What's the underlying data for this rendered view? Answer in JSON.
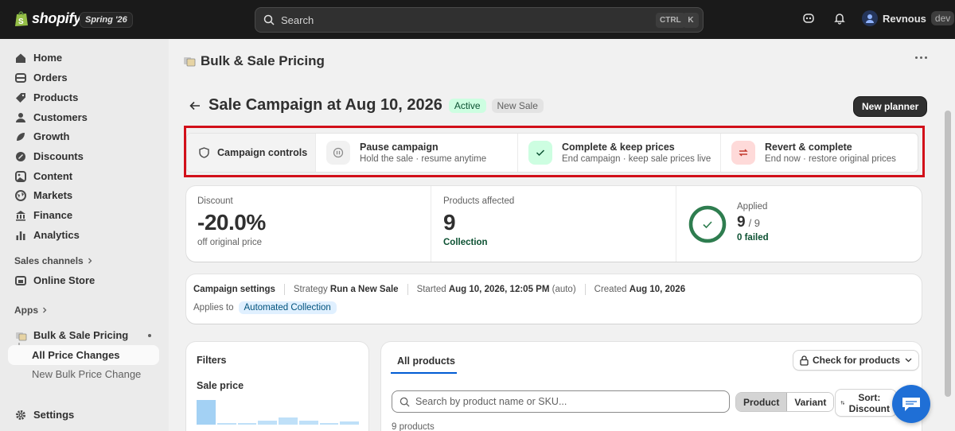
{
  "topbar": {
    "logo_text": "shopify",
    "release_badge": "Spring '26",
    "search_placeholder": "Search",
    "shortcut_ctrl": "CTRL",
    "shortcut_key": "K",
    "user_name": "Revnous",
    "user_badge": "dev"
  },
  "sidebar": {
    "items": [
      {
        "label": "Home",
        "icon": "home-icon"
      },
      {
        "label": "Orders",
        "icon": "orders-icon"
      },
      {
        "label": "Products",
        "icon": "tag-icon"
      },
      {
        "label": "Customers",
        "icon": "person-icon"
      },
      {
        "label": "Growth",
        "icon": "growth-icon"
      },
      {
        "label": "Discounts",
        "icon": "discount-icon"
      },
      {
        "label": "Content",
        "icon": "content-icon"
      },
      {
        "label": "Markets",
        "icon": "globe-icon"
      },
      {
        "label": "Finance",
        "icon": "bank-icon"
      },
      {
        "label": "Analytics",
        "icon": "bar-chart-icon"
      }
    ],
    "sales_channels_label": "Sales channels",
    "online_store_label": "Online Store",
    "apps_label": "Apps",
    "app_label": "Bulk & Sale Pricing",
    "app_sub_items": [
      "All Price Changes",
      "New Bulk Price Change"
    ],
    "settings_label": "Settings"
  },
  "app_header": {
    "title": "Bulk & Sale Pricing"
  },
  "page": {
    "title": "Sale Campaign at Aug 10, 2026",
    "status_badge": "Active",
    "type_badge": "New Sale",
    "primary_action": "New planner"
  },
  "controls": {
    "title": "Campaign controls",
    "pause": {
      "title": "Pause campaign",
      "subtitle": "Hold the sale · resume anytime"
    },
    "complete": {
      "title": "Complete & keep prices",
      "subtitle": "End campaign · keep sale prices live"
    },
    "revert": {
      "title": "Revert & complete",
      "subtitle": "End now · restore original prices"
    }
  },
  "stats": {
    "discount_label": "Discount",
    "discount_value": "-20.0%",
    "discount_sub": "off original price",
    "products_label": "Products affected",
    "products_value": "9",
    "products_sub": "Collection",
    "applied_label": "Applied",
    "applied_value": "9",
    "applied_total": "/ 9",
    "failed_text": "0 failed",
    "applied_fraction": 1.0
  },
  "settings": {
    "label": "Campaign settings",
    "strategy_label": "Strategy",
    "strategy_value": "Run a New Sale",
    "started_label": "Started",
    "started_value": "Aug 10, 2026, 12:05 PM",
    "started_note": "(auto)",
    "created_label": "Created",
    "created_value": "Aug 10, 2026",
    "applies_label": "Applies to",
    "applies_value": "Automated Collection"
  },
  "filters": {
    "title": "Filters",
    "sale_price_label": "Sale price",
    "histogram": [
      1.0,
      0.05,
      0.05,
      0.17,
      0.3,
      0.17,
      0.05,
      0.12
    ]
  },
  "products": {
    "tab_label": "All products",
    "check_button": "Check for products",
    "search_placeholder": "Search by product name or SKU...",
    "segment_product": "Product",
    "segment_variant": "Variant",
    "sort_label": "Sort:",
    "sort_value": "Discount",
    "count_text": "9 products"
  },
  "colors": {
    "topbar": "#1a1a1a",
    "active_badge_bg": "#cdfee1",
    "active_badge_fg": "#0c5132",
    "progress_ring": "#2e7d4f",
    "highlight_box": "#d20f19",
    "chat_button": "#1f6fd6"
  }
}
